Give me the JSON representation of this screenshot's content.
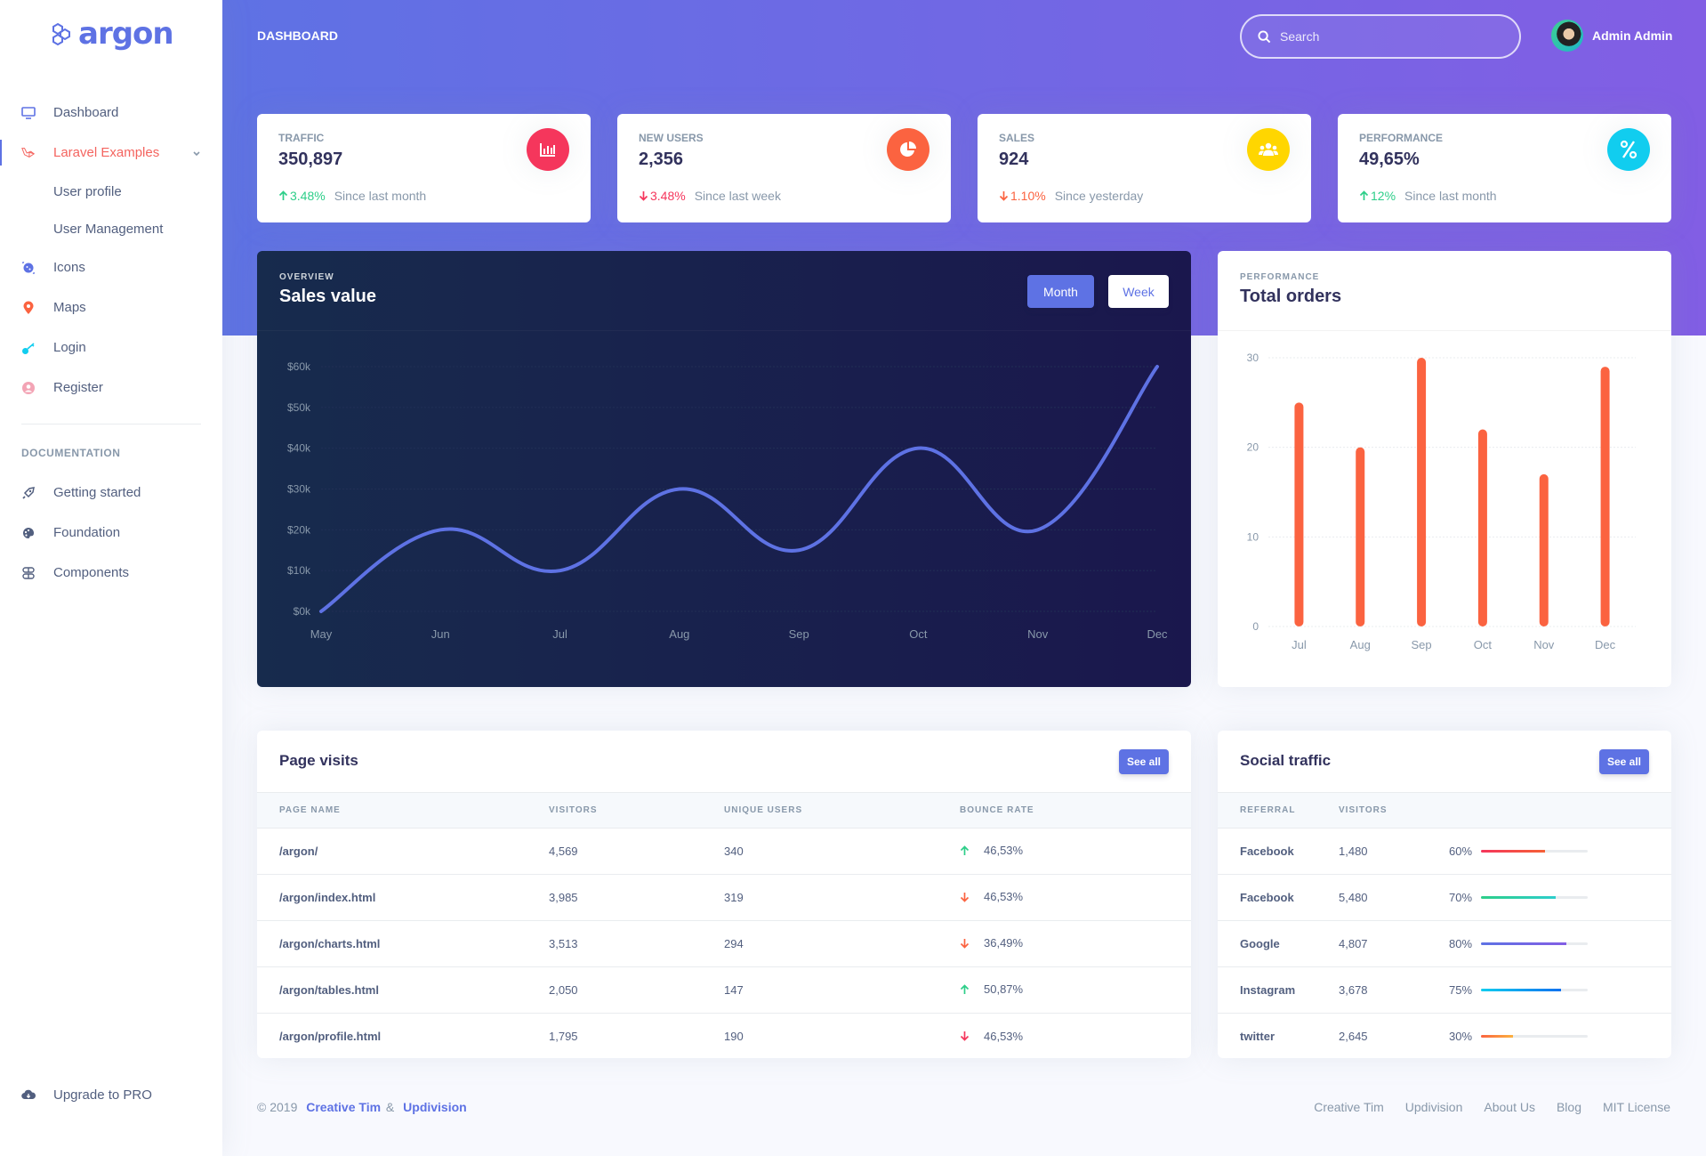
{
  "brand": {
    "name": "argon"
  },
  "sidebar": {
    "items": [
      {
        "label": "Dashboard",
        "icon": "tv-icon",
        "color": "#5e72e4"
      },
      {
        "label": "Laravel Examples",
        "icon": "laravel-icon",
        "color": "#f4645f",
        "active": true
      },
      {
        "label": "Icons",
        "icon": "planet-icon",
        "color": "#5e72e4"
      },
      {
        "label": "Maps",
        "icon": "pin-icon",
        "color": "#fb6340"
      },
      {
        "label": "Login",
        "icon": "key-icon",
        "color": "#11cdef"
      },
      {
        "label": "Register",
        "icon": "user-circle-icon",
        "color": "#f3a4b5"
      }
    ],
    "subitems": [
      {
        "label": "User profile"
      },
      {
        "label": "User Management"
      }
    ],
    "doc_heading": "Documentation",
    "doc_items": [
      {
        "label": "Getting started",
        "icon": "rocket-icon"
      },
      {
        "label": "Foundation",
        "icon": "palette-icon"
      },
      {
        "label": "Components",
        "icon": "components-icon"
      }
    ],
    "upgrade": {
      "label": "Upgrade to PRO",
      "icon": "cloud-download-icon"
    }
  },
  "header": {
    "title": "Dashboard",
    "search_placeholder": "Search",
    "user_name": "Admin Admin"
  },
  "stats": [
    {
      "title": "Traffic",
      "value": "350,897",
      "change": "3.48%",
      "direction": "up",
      "change_color": "#2dce89",
      "since": "Since last month",
      "icon": "chart-bar-icon",
      "icon_bg": "#f5365c"
    },
    {
      "title": "New users",
      "value": "2,356",
      "change": "3.48%",
      "direction": "down",
      "change_color": "#f5365c",
      "since": "Since last week",
      "icon": "chart-pie-icon",
      "icon_bg": "#fb6340"
    },
    {
      "title": "Sales",
      "value": "924",
      "change": "1.10%",
      "direction": "down",
      "change_color": "#fb6340",
      "since": "Since yesterday",
      "icon": "users-icon",
      "icon_bg": "#ffd600"
    },
    {
      "title": "Performance",
      "value": "49,65%",
      "change": "12%",
      "direction": "up",
      "change_color": "#2dce89",
      "since": "Since last month",
      "icon": "percent-icon",
      "icon_bg": "#11cdef"
    }
  ],
  "sales_card": {
    "overline": "Overview",
    "title": "Sales value",
    "tabs": [
      {
        "label": "Month",
        "active": true
      },
      {
        "label": "Week",
        "active": false
      }
    ]
  },
  "orders_card": {
    "overline": "Performance",
    "title": "Total orders"
  },
  "chart_data": [
    {
      "type": "line",
      "title": "Sales value",
      "categories": [
        "May",
        "Jun",
        "Jul",
        "Aug",
        "Sep",
        "Oct",
        "Nov",
        "Dec"
      ],
      "values": [
        0,
        20,
        10,
        30,
        15,
        40,
        20,
        60
      ],
      "unit": "thousand USD",
      "ylim": [
        0,
        60
      ],
      "yticks": [
        0,
        10,
        20,
        30,
        40,
        50,
        60
      ],
      "ytick_labels": [
        "$0k",
        "$10k",
        "$20k",
        "$30k",
        "$40k",
        "$50k",
        "$60k"
      ],
      "grid": true,
      "line_color": "#5e72e4",
      "xlabel": "",
      "ylabel": ""
    },
    {
      "type": "bar",
      "title": "Total orders",
      "categories": [
        "Jul",
        "Aug",
        "Sep",
        "Oct",
        "Nov",
        "Dec"
      ],
      "values": [
        25,
        20,
        30,
        22,
        17,
        29
      ],
      "ylim": [
        0,
        30
      ],
      "yticks": [
        0,
        10,
        20,
        30
      ],
      "ytick_labels": [
        "0",
        "10",
        "20",
        "30"
      ],
      "grid": true,
      "bar_color": "#fb6340",
      "xlabel": "",
      "ylabel": ""
    }
  ],
  "page_visits": {
    "title": "Page visits",
    "see_all": "See all",
    "columns": [
      "Page name",
      "Visitors",
      "Unique users",
      "Bounce rate"
    ],
    "rows": [
      {
        "page": "/argon/",
        "visitors": "4,569",
        "unique": "340",
        "bounce": "46,53%",
        "direction": "up",
        "color": "#2dce89"
      },
      {
        "page": "/argon/index.html",
        "visitors": "3,985",
        "unique": "319",
        "bounce": "46,53%",
        "direction": "down",
        "color": "#fb6340"
      },
      {
        "page": "/argon/charts.html",
        "visitors": "3,513",
        "unique": "294",
        "bounce": "36,49%",
        "direction": "down",
        "color": "#fb6340"
      },
      {
        "page": "/argon/tables.html",
        "visitors": "2,050",
        "unique": "147",
        "bounce": "50,87%",
        "direction": "up",
        "color": "#2dce89"
      },
      {
        "page": "/argon/profile.html",
        "visitors": "1,795",
        "unique": "190",
        "bounce": "46,53%",
        "direction": "down",
        "color": "#f5365c"
      }
    ]
  },
  "social_traffic": {
    "title": "Social traffic",
    "see_all": "See all",
    "columns": [
      "Referral",
      "Visitors",
      ""
    ],
    "rows": [
      {
        "referral": "Facebook",
        "visitors": "1,480",
        "percent_label": "60%",
        "percent": 60,
        "gradient": [
          "#f5365c",
          "#f56036"
        ]
      },
      {
        "referral": "Facebook",
        "visitors": "5,480",
        "percent_label": "70%",
        "percent": 70,
        "gradient": [
          "#2dce89",
          "#2dcecc"
        ]
      },
      {
        "referral": "Google",
        "visitors": "4,807",
        "percent_label": "80%",
        "percent": 80,
        "gradient": [
          "#5e72e4",
          "#825ee4"
        ]
      },
      {
        "referral": "Instagram",
        "visitors": "3,678",
        "percent_label": "75%",
        "percent": 75,
        "gradient": [
          "#11cdef",
          "#1171ef"
        ]
      },
      {
        "referral": "twitter",
        "visitors": "2,645",
        "percent_label": "30%",
        "percent": 30,
        "gradient": [
          "#fb6340",
          "#fbb140"
        ]
      }
    ]
  },
  "footer": {
    "copyright": "© 2019",
    "link1": "Creative Tim",
    "amp": "&",
    "link2": "Updivision",
    "links": [
      "Creative Tim",
      "Updivision",
      "About Us",
      "Blog",
      "MIT License"
    ]
  }
}
